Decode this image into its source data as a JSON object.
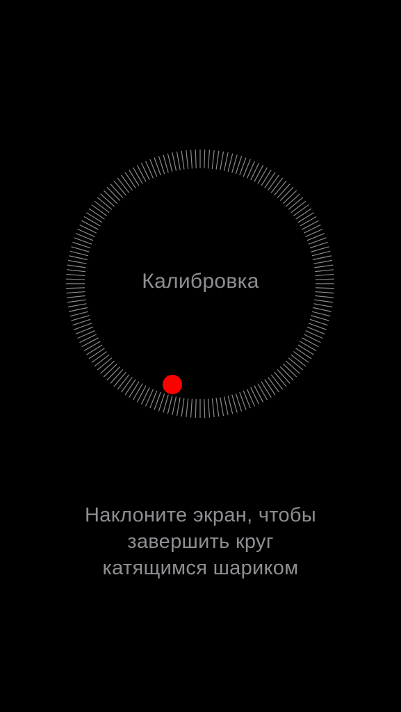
{
  "screen": {
    "title": "Калибровка",
    "instructions": [
      "Наклоните экран, чтобы",
      "завершить круг",
      "катящимся шариком"
    ]
  },
  "colors": {
    "background": "#000000",
    "tick": "#ffffff",
    "ball": "#ff0000",
    "text": "#8e8e93"
  },
  "icons": {
    "ring": "calibration-ring",
    "ball": "rolling-ball"
  }
}
